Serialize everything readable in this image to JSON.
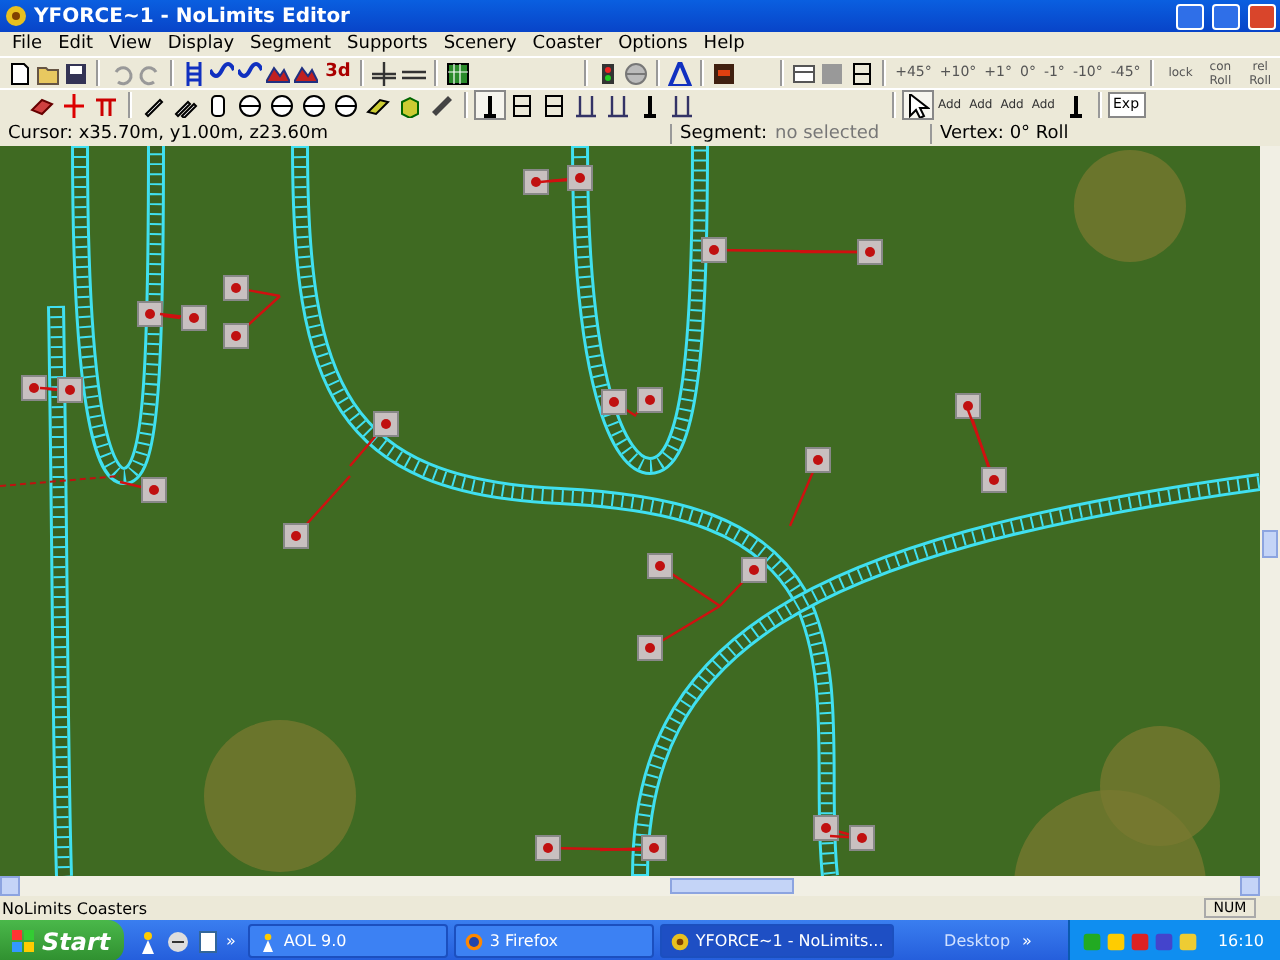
{
  "window": {
    "title": "YFORCE~1 - NoLimits Editor"
  },
  "menu": [
    "File",
    "Edit",
    "View",
    "Display",
    "Segment",
    "Supports",
    "Scenery",
    "Coaster",
    "Options",
    "Help"
  ],
  "toolbar_1": {
    "text_buttons": [
      "3d"
    ],
    "roll_buttons": [
      "+45°",
      "+10°",
      "+1°",
      "0°",
      "-1°",
      "-10°",
      "-45°"
    ],
    "roll_mode_buttons": [
      "lock",
      "con Roll",
      "rel Roll"
    ]
  },
  "toolbar_2": {
    "add_buttons": [
      "Add",
      "Add",
      "Add",
      "Add"
    ],
    "exp_button": "Exp"
  },
  "info_bar": {
    "cursor": "Cursor: x35.70m, y1.00m, z23.60m",
    "segment_label": "Segment:",
    "segment_value": "no selected",
    "vertex": "Vertex: 0° Roll"
  },
  "status_bar": {
    "text": "NoLimits Coasters",
    "num": "NUM"
  },
  "taskbar": {
    "start": "Start",
    "quick_more": "»",
    "tasks": [
      {
        "label": "AOL 9.0",
        "selected": false
      },
      {
        "label": "3 Firefox",
        "selected": false
      },
      {
        "label": "YFORCE~1 - NoLimits...",
        "selected": true
      }
    ],
    "desktop": "Desktop",
    "desktop_more": "»",
    "clock": "16:10"
  }
}
